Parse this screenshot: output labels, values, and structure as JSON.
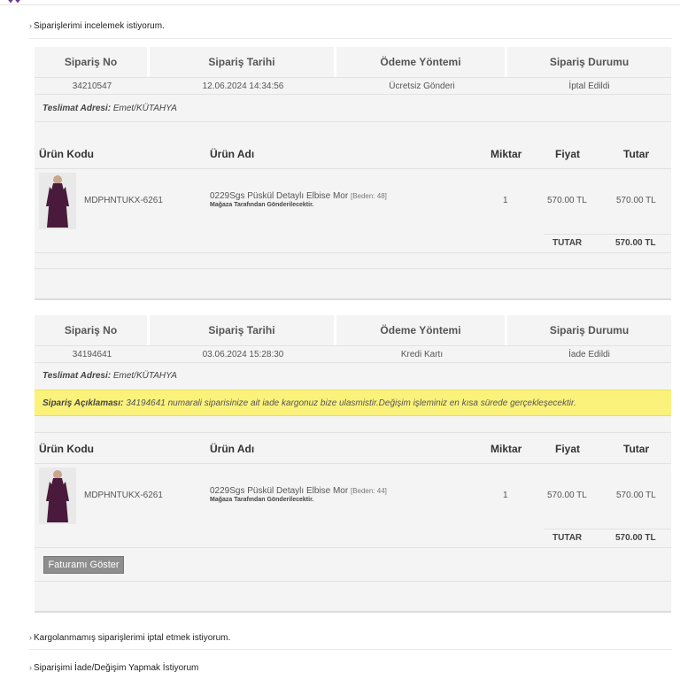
{
  "faq": [
    {
      "arrow": "›",
      "label": "Siparişlerimi incelemek istiyorum."
    },
    {
      "arrow": "›",
      "label": "Kargolanmamış siparişlerimi iptal etmek istiyorum."
    },
    {
      "arrow": "›",
      "label": "Siparişimi İade/Değişim Yapmak İstiyorum"
    }
  ],
  "order_headers": {
    "order_no": "Sipariş No",
    "order_date": "Sipariş Tarihi",
    "payment": "Ödeme Yöntemi",
    "status": "Sipariş Durumu"
  },
  "product_headers": {
    "code": "Ürün Kodu",
    "name": "Ürün Adı",
    "qty": "Miktar",
    "price": "Fiyat",
    "total": "Tutar"
  },
  "address_label": "Teslimat Adresi:",
  "note_label": "Sipariş Açıklaması:",
  "total_label": "TUTAR",
  "invoice_button": "Faturamı Göster",
  "orders": [
    {
      "order_no": "34210547",
      "order_date": "12.06.2024 14:34:56",
      "payment": "Ücretsiz Gönderi",
      "status": "İptal Edildi",
      "address": "Emet/KÜTAHYA",
      "product": {
        "code": "MDPHNTUKX-6261",
        "name": "0229Sgs Püskül Detaylı Elbise Mor",
        "size": "[Beden: 48]",
        "sub": "Mağaza Tarafından Gönderilecektir.",
        "qty": "1",
        "price": "570.00 TL",
        "total": "570.00 TL"
      },
      "grand_total": "570.00 TL"
    },
    {
      "order_no": "34194641",
      "order_date": "03.06.2024 15:28:30",
      "payment": "Kredi Kartı",
      "status": "İade Edildi",
      "address": "Emet/KÜTAHYA",
      "note": "34194641 numarali siparisinize ait iade kargonuz bize ulasmistir.Değişim işleminiz en kısa sürede gerçekleşecektir.",
      "product": {
        "code": "MDPHNTUKX-6261",
        "name": "0229Sgs Püskül Detaylı Elbise Mor",
        "size": "[Beden: 44]",
        "sub": "Mağaza Tarafından Gönderilecektir.",
        "qty": "1",
        "price": "570.00 TL",
        "total": "570.00 TL"
      },
      "grand_total": "570.00 TL"
    }
  ],
  "colors": {
    "panel_bg": "#f4f4f4",
    "note_bg": "#fbf27c",
    "button_bg": "#8e8e8e",
    "dress": "#4a1a3c",
    "logo": "#6b3a8e"
  },
  "icons": {
    "logo": "brand-logo-fragment",
    "product": "dress-product-image"
  }
}
